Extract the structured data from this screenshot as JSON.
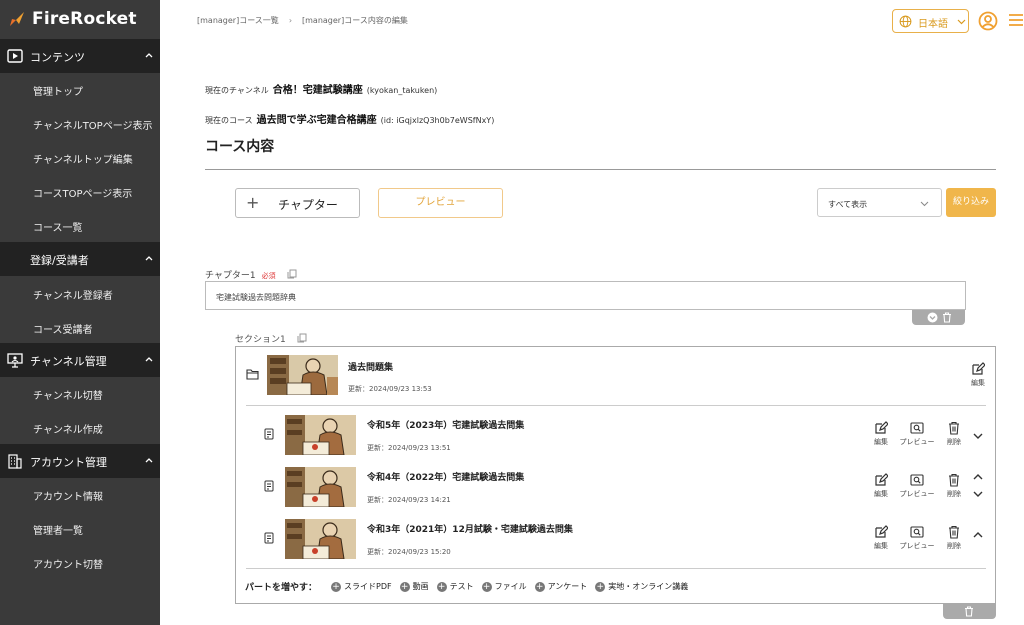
{
  "sidebar": {
    "logo": "FireRocket",
    "sections": [
      {
        "label": "コンテンツ",
        "items": [
          "管理トップ",
          "チャンネルTOPページ表示",
          "チャンネルトップ編集",
          "コースTOPページ表示",
          "コース一覧"
        ]
      },
      {
        "label": "登録/受講者",
        "items": [
          "チャンネル登録者",
          "コース受講者"
        ]
      },
      {
        "label": "チャンネル管理",
        "items": [
          "チャンネル切替",
          "チャンネル作成"
        ]
      },
      {
        "label": "アカウント管理",
        "items": [
          "アカウント情報",
          "管理者一覧",
          "アカウント切替"
        ]
      }
    ]
  },
  "header": {
    "breadcrumb": [
      "[manager]コース一覧",
      "[manager]コース内容の編集"
    ],
    "breadcrumb_sep": "›",
    "language": "日本語"
  },
  "channel": {
    "label": "現在のチャンネル",
    "name": "合格！宅建試験講座",
    "id": "(kyokan_takuken)"
  },
  "course": {
    "label": "現在のコース",
    "name": "過去問で学ぶ宅建合格講座",
    "id": "(id: iGqjxlzQ3h0b7eWSfNxY)"
  },
  "page_title": "コース内容",
  "toolbar": {
    "chapter_plus": "+",
    "chapter_label": "チャプター",
    "preview_label": "プレビュー",
    "filter_value": "すべて表示",
    "filter_button": "絞り込み"
  },
  "chapter": {
    "label": "チャプター1",
    "required": "必須",
    "value": "宅建試験過去問題辞典"
  },
  "section": {
    "label": "セクション1",
    "folder": {
      "title": "過去問題集",
      "date": "更新：2024/09/23 13:53",
      "edit": "編集"
    },
    "items": [
      {
        "title": "令和5年（2023年）宅建試験過去問集",
        "date": "更新：2024/09/23 13:51"
      },
      {
        "title": "令和4年（2022年）宅建試験過去問集",
        "date": "更新：2024/09/23 14:21"
      },
      {
        "title": "令和3年（2021年）12月試験・宅建試験過去問集",
        "date": "更新：2024/09/23 15:20"
      }
    ],
    "actions": {
      "edit": "編集",
      "preview": "プレビュー",
      "delete": "削除"
    },
    "parts_label": "パートを増やす：",
    "parts": [
      "スライドPDF",
      "動画",
      "テスト",
      "ファイル",
      "アンケート",
      "実地・オンライン講義"
    ],
    "parts_plus": "+"
  },
  "colors": {
    "accent": "#f0b64b",
    "sidebar": "#3a3a3a",
    "sidebar_section": "#222222",
    "required": "#dd3333"
  }
}
